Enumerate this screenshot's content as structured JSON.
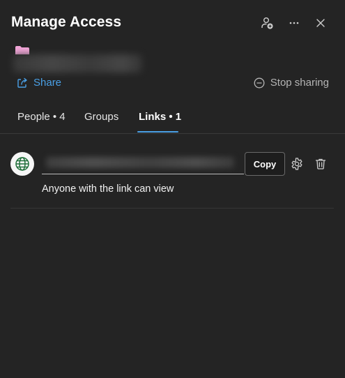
{
  "header": {
    "title": "Manage Access",
    "icons": {
      "add_person": "person-add-icon",
      "more": "more-options-icon",
      "close": "close-icon"
    }
  },
  "item": {
    "icon": "folder-icon",
    "icon_color": "#f2a6d8"
  },
  "actions": {
    "share_label": "Share",
    "share_icon": "share-icon",
    "stop_sharing_label": "Stop sharing",
    "stop_sharing_icon": "stop-circle-icon"
  },
  "tabs": [
    {
      "label": "People • 4",
      "active": false
    },
    {
      "label": "Groups",
      "active": false
    },
    {
      "label": "Links • 1",
      "active": true
    }
  ],
  "links": [
    {
      "icon": "globe-icon",
      "copy_label": "Copy",
      "permission": "Anyone with the link can view",
      "settings_icon": "gear-icon",
      "delete_icon": "trash-icon"
    }
  ],
  "colors": {
    "background": "#242424",
    "accent": "#4aa0e6",
    "globe": "#1f6f3a"
  }
}
